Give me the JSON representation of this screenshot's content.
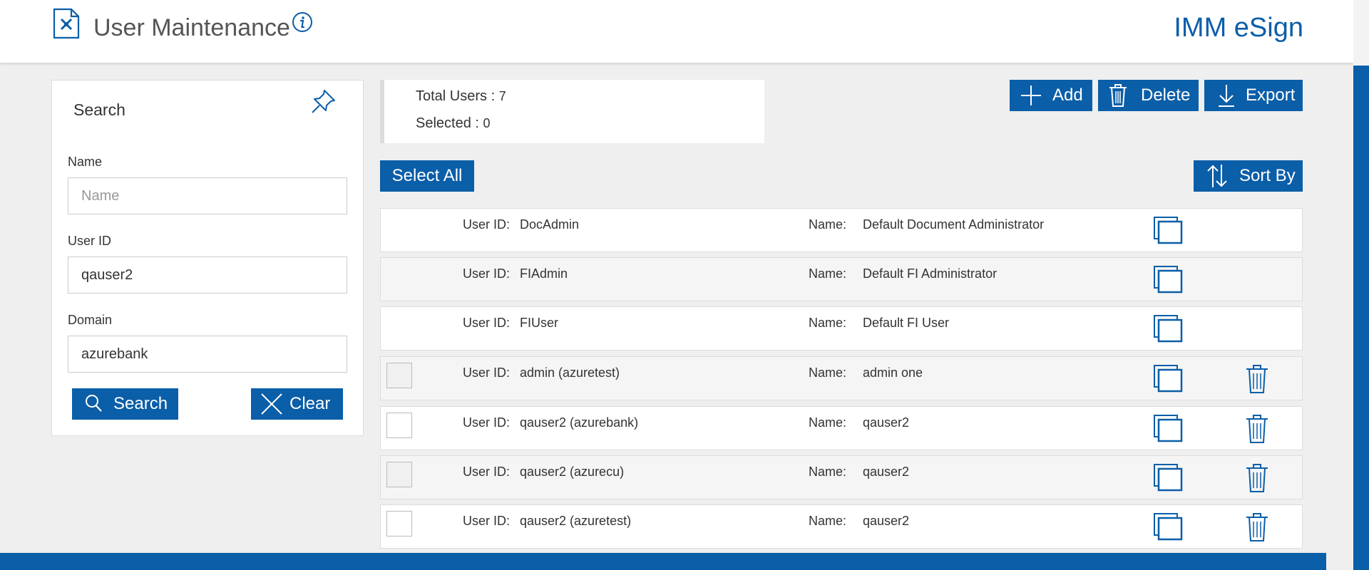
{
  "header": {
    "title": "User Maintenance",
    "brand": "IMM eSign"
  },
  "search_panel": {
    "title": "Search",
    "fields": [
      {
        "label": "Name",
        "value": "",
        "placeholder": "Name"
      },
      {
        "label": "User ID",
        "value": "qauser2",
        "placeholder": ""
      },
      {
        "label": "Domain",
        "value": "azurebank",
        "placeholder": ""
      }
    ],
    "search_label": "Search",
    "clear_label": "Clear"
  },
  "summary": {
    "total_label": "Total Users : ",
    "total_value": "7",
    "selected_label": "Selected : ",
    "selected_value": "0"
  },
  "toolbar": {
    "add_label": "Add",
    "delete_label": "Delete",
    "export_label": "Export",
    "select_all_label": "Select All",
    "sort_by_label": "Sort By"
  },
  "list": {
    "user_id_label": "User ID:",
    "name_label": "Name:",
    "rows": [
      {
        "user_id": "DocAdmin",
        "name": "Default Document Administrator",
        "selectable": false,
        "deletable": false
      },
      {
        "user_id": "FIAdmin",
        "name": "Default FI Administrator",
        "selectable": false,
        "deletable": false
      },
      {
        "user_id": "FIUser",
        "name": "Default FI User",
        "selectable": false,
        "deletable": false
      },
      {
        "user_id": "admin (azuretest)",
        "name": "admin one",
        "selectable": true,
        "deletable": true
      },
      {
        "user_id": "qauser2 (azurebank)",
        "name": "qauser2",
        "selectable": true,
        "deletable": true
      },
      {
        "user_id": "qauser2 (azurecu)",
        "name": "qauser2",
        "selectable": true,
        "deletable": true
      },
      {
        "user_id": "qauser2 (azuretest)",
        "name": "qauser2",
        "selectable": true,
        "deletable": true
      }
    ]
  },
  "colors": {
    "accent": "#0b5ea8",
    "background": "#efefef"
  },
  "icons": [
    "tools-document-icon",
    "info-icon",
    "pin-icon",
    "search-icon",
    "close-icon",
    "plus-icon",
    "trash-icon",
    "download-icon",
    "sort-icon",
    "copy-icon"
  ]
}
